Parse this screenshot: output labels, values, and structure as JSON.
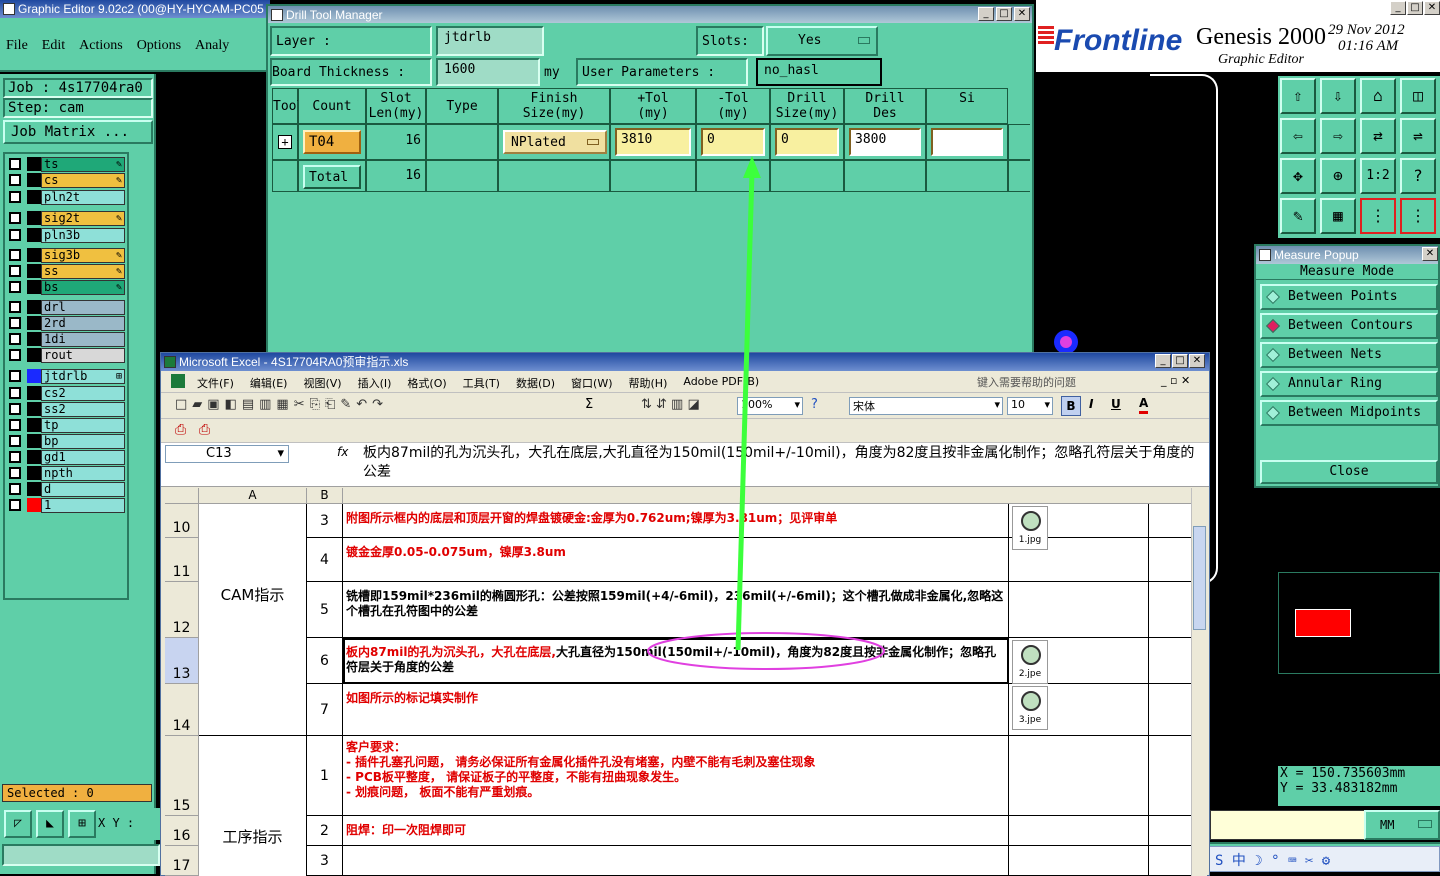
{
  "app": {
    "title": "Graphic Editor 9.02c2 (00@HY-HYCAM-PC05",
    "menu": [
      "File",
      "Edit",
      "Actions",
      "Options",
      "Analy"
    ]
  },
  "brand": {
    "logo": "Frontline",
    "product": "Genesis 2000",
    "subtitle": "Graphic Editor",
    "date": "29 Nov 2012",
    "time": "01:16 AM"
  },
  "left": {
    "job": "Job : 4s17704ra0",
    "step": "Step: cam",
    "job_matrix": "Job Matrix ...",
    "selected": "Selected : 0",
    "xy": "X Y :",
    "layers": [
      {
        "name": "ts",
        "color": "#1fa878",
        "mark": "✎"
      },
      {
        "name": "cs",
        "color": "#f0c040",
        "mark": "✎"
      },
      {
        "name": "pln2t",
        "color": "#8ee0d8",
        "mark": ""
      },
      {
        "name": "sig2t",
        "color": "#f0c040",
        "mark": "✎"
      },
      {
        "name": "pln3b",
        "color": "#8ee0d8",
        "mark": ""
      },
      {
        "name": "sig3b",
        "color": "#f0c040",
        "mark": "✎"
      },
      {
        "name": "ss",
        "color": "#f0c040",
        "mark": "✎"
      },
      {
        "name": "bs",
        "color": "#1fa878",
        "mark": "✎"
      },
      {
        "name": "drl",
        "color": "#9ab8c8",
        "mark": ""
      },
      {
        "name": "2rd",
        "color": "#9ab8c8",
        "mark": ""
      },
      {
        "name": "1di",
        "color": "#9ab8c8",
        "mark": ""
      },
      {
        "name": "rout",
        "color": "#d8d8d8",
        "mark": ""
      },
      {
        "name": "jtdrlb",
        "color": "#8ee0d8",
        "mark": "⊞"
      },
      {
        "name": "cs2",
        "color": "#8ee0d8",
        "mark": ""
      },
      {
        "name": "ss2",
        "color": "#8ee0d8",
        "mark": ""
      },
      {
        "name": "tp",
        "color": "#8ee0d8",
        "mark": ""
      },
      {
        "name": "bp",
        "color": "#8ee0d8",
        "mark": ""
      },
      {
        "name": "gd1",
        "color": "#8ee0d8",
        "mark": ""
      },
      {
        "name": "npth",
        "color": "#8ee0d8",
        "mark": ""
      },
      {
        "name": "d",
        "color": "#8ee0d8",
        "mark": ""
      },
      {
        "name": "1",
        "color": "#8ee0d8",
        "mark": ""
      }
    ]
  },
  "drill": {
    "title": "Drill Tool Manager",
    "layer_label": "Layer          :",
    "layer_value": "jtdrlb",
    "slots_label": "Slots:",
    "slots_value": "Yes",
    "thick_label": "Board Thickness :",
    "thick_value": "1600",
    "thick_unit": "my",
    "user_params_label": "User Parameters  :",
    "user_params_value": "no_hasl",
    "headers": [
      "Tool",
      "Count",
      "Slot\nLen(my)",
      "Type",
      "Finish\nSize(my)",
      "+Tol\n(my)",
      "-Tol\n(my)",
      "Drill\nSize(my)",
      "Drill\nDes",
      "Si"
    ],
    "row": {
      "tool": "T04",
      "count": "16",
      "type": "NPlated",
      "finish": "3810",
      "ptol": "0",
      "mtol": "0",
      "drill": "3800",
      "des": ""
    },
    "total": {
      "label": "Total",
      "count": "16"
    }
  },
  "measure": {
    "title": "Measure Popup",
    "header": "Measure Mode",
    "modes": [
      "Between Points",
      "Between Contours",
      "Between Nets",
      "Annular Ring",
      "Between Midpoints"
    ],
    "close": "Close"
  },
  "coords": {
    "x": "X  =  150.735603mm",
    "y": "Y  =  33.483182mm",
    "unit": "MM"
  },
  "excel": {
    "title": "Microsoft Excel - 4S17704RA0预审指示.xls",
    "menu": [
      "文件(F)",
      "编辑(E)",
      "视图(V)",
      "插入(I)",
      "格式(O)",
      "工具(T)",
      "数据(D)",
      "窗口(W)",
      "帮助(H)",
      "Adobe PDF(B)"
    ],
    "help_placeholder": "键入需要帮助的问题",
    "zoom": "100%",
    "font": "宋体",
    "size": "10",
    "cellref": "C13",
    "formula": "板内87mil的孔为沉头孔，大孔在底层,大孔直径为150mil(150mil+/-10mil)，角度为82度且按非金属化制作；忽略孔符层关于角度的公差",
    "colA": "A",
    "colB": "B",
    "rownums": [
      "10",
      "11",
      "12",
      "13",
      "14",
      "15",
      "16",
      "17"
    ],
    "groupA1": "CAM指示",
    "groupA2": "工序指示",
    "rows": [
      {
        "n": "3",
        "text": "附图所示框内的底层和顶层开窗的焊盘镀硬金:金厚为0.762um;镍厚为3.81um；见评审单",
        "red": true,
        "img": "1.jpg"
      },
      {
        "n": "4",
        "text": "镀金金厚0.05-0.075um，镍厚3.8um",
        "red": true,
        "img": ""
      },
      {
        "n": "5",
        "text": "铣槽即159mil*236mil的椭圆形孔：公差按照159mil(+4/-6mil)，236mil(+/-6mil)；这个槽孔做成非金属化,忽略这个槽孔在孔符图中的公差",
        "red": false,
        "img": ""
      },
      {
        "n": "6",
        "text_red": "板内87mil的孔为沉头孔，大孔在底层,",
        "text": "大孔直径为150mil(150mil+/-10mil)，角度为82度且按非金属化制作；忽略孔符层关于角度的公差",
        "img": "2.jpe"
      },
      {
        "n": "7",
        "text": "如图所示的标记填实制作",
        "red": true,
        "img": "3.jpe"
      },
      {
        "n": "1",
        "lines": [
          "客户要求：",
          "- 插件孔塞孔问题，  请务必保证所有金属化插件孔没有堵塞，内壁不能有毛刺及塞住现象",
          "- PCB板平整度，  请保证板子的平整度，不能有扭曲现象发生。",
          "- 划痕问题，  板面不能有严重划痕。"
        ]
      },
      {
        "n": "2",
        "text": "阻焊：印一次阻焊即可",
        "red": true
      },
      {
        "n": "3",
        "text": ""
      }
    ]
  },
  "colors": {
    "teal": "#5fcfa8",
    "accent": "#f0b040",
    "arrow": "#3cff3c",
    "ellipse": "#e040e0"
  }
}
